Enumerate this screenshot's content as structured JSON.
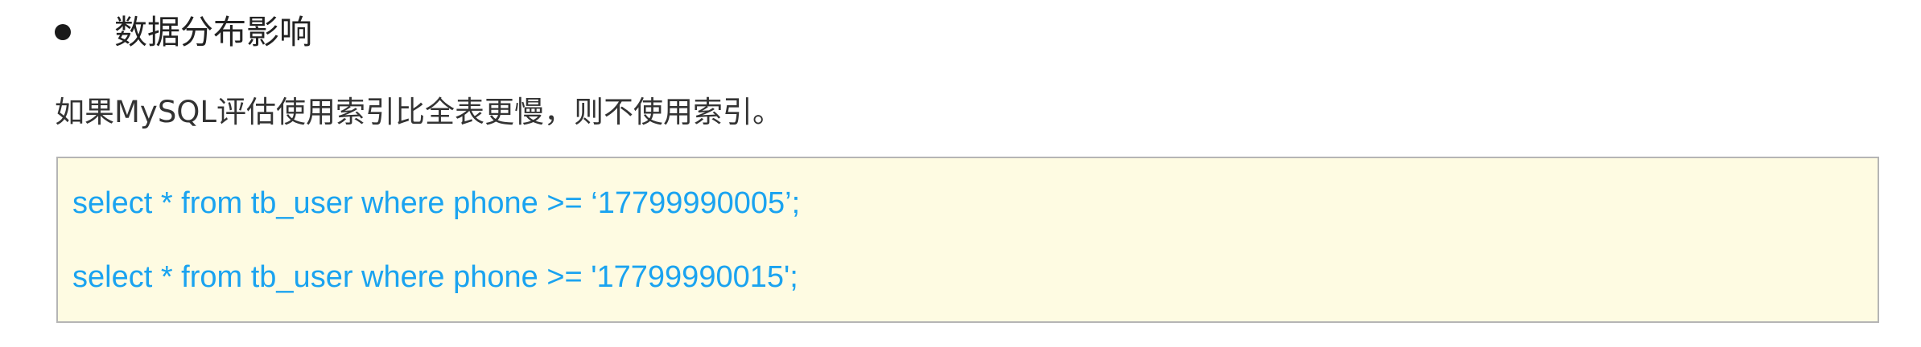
{
  "section": {
    "heading": "数据分布影响",
    "paragraph": "如果MySQL评估使用索引比全表更慢，则不使用索引。"
  },
  "code_block": {
    "lines": [
      "select * from tb_user where phone >= ‘17799990005’;",
      "select * from tb_user where phone >= '17799990015';"
    ]
  },
  "colors": {
    "code_text": "#1aa3f0",
    "code_background": "#fefbe2",
    "code_border": "#b5b5b5"
  }
}
